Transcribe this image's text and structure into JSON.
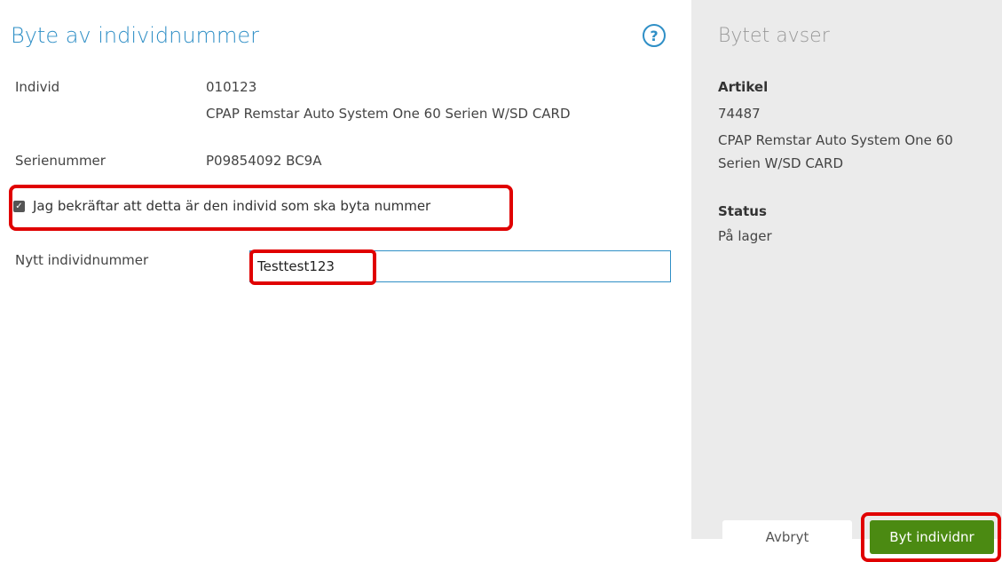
{
  "dialog": {
    "title": "Byte av individnummer",
    "help_icon": "?",
    "fields": {
      "individ_label": "Individ",
      "individ_number": "010123",
      "individ_description": "CPAP Remstar Auto System One 60 Serien W/SD CARD",
      "serial_label": "Serienummer",
      "serial_value": "P09854092 BC9A"
    },
    "confirm": {
      "checked": true,
      "label": "Jag bekräftar att detta är den individ som ska byta nummer"
    },
    "new_number": {
      "label": "Nytt individnummer",
      "value": "Testtest123"
    }
  },
  "summary": {
    "title": "Bytet avser",
    "article_heading": "Artikel",
    "article_number": "74487",
    "article_line1": "CPAP Remstar Auto System One 60",
    "article_line2": "Serien W/SD CARD",
    "status_heading": "Status",
    "status_value": "På lager"
  },
  "actions": {
    "cancel_label": "Avbryt",
    "submit_label": "Byt individnr"
  },
  "colors": {
    "accent": "#2f8fc6",
    "primary": "#4b8a12",
    "highlight": "#e00000",
    "side_panel": "#ebebeb"
  }
}
